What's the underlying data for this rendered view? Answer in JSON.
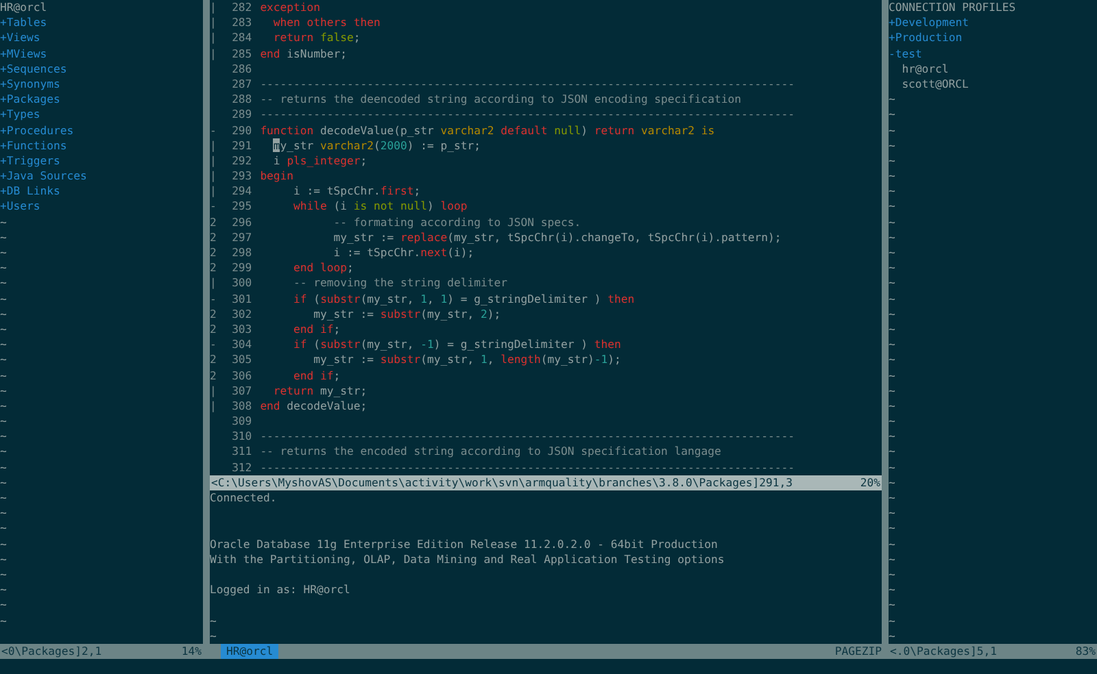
{
  "left_pane": {
    "title": "HR@orcl",
    "items": [
      {
        "label": "+Tables"
      },
      {
        "label": "+Views"
      },
      {
        "label": "+MViews"
      },
      {
        "label": "+Sequences"
      },
      {
        "label": "+Synonyms"
      },
      {
        "label": "+Packages"
      },
      {
        "label": "+Types"
      },
      {
        "label": "+Procedures"
      },
      {
        "label": "+Functions"
      },
      {
        "label": "+Triggers"
      },
      {
        "label": "+Java Sources"
      },
      {
        "label": "+DB Links"
      },
      {
        "label": "+Users"
      }
    ],
    "filler": [
      "~",
      "~",
      "~",
      "~",
      "~",
      "~",
      "~",
      "~",
      "~",
      "~",
      "~",
      "~",
      "~",
      "~",
      "~",
      "~",
      "~",
      "~",
      "~",
      "~",
      "~",
      "~",
      "~",
      "~",
      "~",
      "~",
      "~"
    ],
    "status_bar": {
      "file": "<0\\Packages]2,1",
      "percent": "14%"
    }
  },
  "editor": {
    "lines": [
      {
        "fold": "|",
        "number": "282",
        "tokens": [
          {
            "kind": "kw",
            "text": "exception"
          }
        ]
      },
      {
        "fold": "|",
        "number": "283",
        "tokens": [
          {
            "kind": "kw",
            "text": "  when others then"
          }
        ]
      },
      {
        "fold": "|",
        "number": "284",
        "tokens": [
          {
            "kind": "kw",
            "text": "  return"
          },
          {
            "kind": "const",
            "text": " false"
          },
          {
            "kind": "plain",
            "text": ";"
          }
        ]
      },
      {
        "fold": "|",
        "number": "285",
        "tokens": [
          {
            "kind": "kw",
            "text": "end"
          },
          {
            "kind": "plain",
            "text": " isNumber;"
          }
        ]
      },
      {
        "number": "286"
      },
      {
        "number": "287",
        "tokens": [
          {
            "kind": "comment",
            "text": "--------------------------------------------------------------------------------"
          }
        ]
      },
      {
        "number": "288",
        "tokens": [
          {
            "kind": "comment",
            "text": "-- returns the deencoded string according to JSON encoding specification"
          }
        ]
      },
      {
        "number": "289",
        "tokens": [
          {
            "kind": "comment",
            "text": "--------------------------------------------------------------------------------"
          }
        ]
      },
      {
        "fold": "-",
        "number": "290",
        "tokens": [
          {
            "kind": "kw",
            "text": "function"
          },
          {
            "kind": "plain",
            "text": " decodeValue(p_str "
          },
          {
            "kind": "type",
            "text": "varchar2"
          },
          {
            "kind": "kw",
            "text": " default"
          },
          {
            "kind": "const",
            "text": " null"
          },
          {
            "kind": "plain",
            "text": ") "
          },
          {
            "kind": "kw",
            "text": "return"
          },
          {
            "kind": "type",
            "text": " varchar2 is"
          }
        ]
      },
      {
        "fold": "|",
        "number": "291",
        "tokens": [
          {
            "kind": "cursor",
            "text": "m"
          },
          {
            "kind": "plain",
            "text": "y_str "
          },
          {
            "kind": "type",
            "text": "varchar2"
          },
          {
            "kind": "plain",
            "text": "("
          },
          {
            "kind": "num",
            "text": "2000"
          },
          {
            "kind": "plain",
            "text": ") := p_str;"
          }
        ]
      },
      {
        "fold": "|",
        "number": "292",
        "tokens": [
          {
            "kind": "plain",
            "text": "  i "
          },
          {
            "kind": "kw",
            "text": "pls_integer"
          },
          {
            "kind": "plain",
            "text": ";"
          }
        ]
      },
      {
        "fold": "|",
        "number": "293",
        "tokens": [
          {
            "kind": "kw",
            "text": "begin"
          }
        ]
      },
      {
        "fold": "|",
        "number": "294",
        "tokens": [
          {
            "kind": "plain",
            "text": "     i := tSpcChr."
          },
          {
            "kind": "kw",
            "text": "first"
          },
          {
            "kind": "plain",
            "text": ";"
          }
        ]
      },
      {
        "fold": "-",
        "number": "295",
        "tokens": [
          {
            "kind": "kw",
            "text": "     while"
          },
          {
            "kind": "plain",
            "text": " (i "
          },
          {
            "kind": "const",
            "text": "is not null"
          },
          {
            "kind": "plain",
            "text": ") "
          },
          {
            "kind": "kw",
            "text": "loop"
          }
        ]
      },
      {
        "fold": "2",
        "number": "296",
        "tokens": [
          {
            "kind": "comment",
            "text": "           -- formating according to JSON specs."
          }
        ]
      },
      {
        "fold": "2",
        "number": "297",
        "tokens": [
          {
            "kind": "plain",
            "text": "           my_str := "
          },
          {
            "kind": "kw",
            "text": "replace"
          },
          {
            "kind": "plain",
            "text": "(my_str, tSpcChr(i).changeTo, tSpcChr(i).pattern);"
          }
        ]
      },
      {
        "fold": "2",
        "number": "298",
        "tokens": [
          {
            "kind": "plain",
            "text": "           i := tSpcChr."
          },
          {
            "kind": "kw",
            "text": "next"
          },
          {
            "kind": "plain",
            "text": "(i);"
          }
        ]
      },
      {
        "fold": "2",
        "number": "299",
        "tokens": [
          {
            "kind": "kw",
            "text": "     end loop"
          },
          {
            "kind": "plain",
            "text": ";"
          }
        ]
      },
      {
        "fold": "|",
        "number": "300",
        "tokens": [
          {
            "kind": "comment",
            "text": "     -- removing the string delimiter"
          }
        ]
      },
      {
        "fold": "-",
        "number": "301",
        "tokens": [
          {
            "kind": "kw",
            "text": "     if"
          },
          {
            "kind": "plain",
            "text": " ("
          },
          {
            "kind": "kw",
            "text": "substr"
          },
          {
            "kind": "plain",
            "text": "(my_str, "
          },
          {
            "kind": "num",
            "text": "1"
          },
          {
            "kind": "plain",
            "text": ", "
          },
          {
            "kind": "num",
            "text": "1"
          },
          {
            "kind": "plain",
            "text": ") = g_stringDelimiter ) "
          },
          {
            "kind": "kw",
            "text": "then"
          }
        ]
      },
      {
        "fold": "2",
        "number": "302",
        "tokens": [
          {
            "kind": "plain",
            "text": "        my_str := "
          },
          {
            "kind": "kw",
            "text": "substr"
          },
          {
            "kind": "plain",
            "text": "(my_str, "
          },
          {
            "kind": "num",
            "text": "2"
          },
          {
            "kind": "plain",
            "text": ");"
          }
        ]
      },
      {
        "fold": "2",
        "number": "303",
        "tokens": [
          {
            "kind": "kw",
            "text": "     end if"
          },
          {
            "kind": "plain",
            "text": ";"
          }
        ]
      },
      {
        "fold": "-",
        "number": "304",
        "tokens": [
          {
            "kind": "kw",
            "text": "     if"
          },
          {
            "kind": "plain",
            "text": " ("
          },
          {
            "kind": "kw",
            "text": "substr"
          },
          {
            "kind": "plain",
            "text": "(my_str, "
          },
          {
            "kind": "num",
            "text": "-1"
          },
          {
            "kind": "plain",
            "text": ") = g_stringDelimiter ) "
          },
          {
            "kind": "kw",
            "text": "then"
          }
        ]
      },
      {
        "fold": "2",
        "number": "305",
        "tokens": [
          {
            "kind": "plain",
            "text": "        my_str := "
          },
          {
            "kind": "kw",
            "text": "substr"
          },
          {
            "kind": "plain",
            "text": "(my_str, "
          },
          {
            "kind": "num",
            "text": "1"
          },
          {
            "kind": "plain",
            "text": ", "
          },
          {
            "kind": "kw",
            "text": "length"
          },
          {
            "kind": "plain",
            "text": "(my_str)"
          },
          {
            "kind": "num",
            "text": "-1"
          },
          {
            "kind": "plain",
            "text": ");"
          }
        ]
      },
      {
        "fold": "2",
        "number": "306",
        "tokens": [
          {
            "kind": "kw",
            "text": "     end if"
          },
          {
            "kind": "plain",
            "text": ";"
          }
        ]
      },
      {
        "fold": "|",
        "number": "307",
        "tokens": [
          {
            "kind": "kw",
            "text": "  return"
          },
          {
            "kind": "plain",
            "text": " my_str;"
          }
        ]
      },
      {
        "fold": "|",
        "number": "308",
        "tokens": [
          {
            "kind": "kw",
            "text": "end"
          },
          {
            "kind": "plain",
            "text": " decodeValue;"
          }
        ]
      },
      {
        "number": "309"
      },
      {
        "number": "310",
        "tokens": [
          {
            "kind": "comment",
            "text": "--------------------------------------------------------------------------------"
          }
        ]
      },
      {
        "number": "311",
        "tokens": [
          {
            "kind": "comment",
            "text": "-- returns the encoded string according to JSON specification langage"
          }
        ]
      },
      {
        "number": "312",
        "tokens": [
          {
            "kind": "comment",
            "text": "--------------------------------------------------------------------------------"
          }
        ]
      }
    ],
    "status_bar": {
      "file": "<C:\\Users\\MyshovAS\\Documents\\activity\\work\\svn\\armquality\\branches\\3.8.0\\Packages]291,3",
      "percent": "20%"
    }
  },
  "output": {
    "lines": [
      {
        "kind": "text",
        "text": "Connected."
      },
      {
        "kind": "blank"
      },
      {
        "kind": "blank"
      },
      {
        "kind": "text",
        "text": "Oracle Database 11g Enterprise Edition Release 11.2.0.2.0 - 64bit Production"
      },
      {
        "kind": "text",
        "text": "With the Partitioning, OLAP, Data Mining and Real Application Testing options"
      },
      {
        "kind": "blank"
      },
      {
        "kind": "text",
        "text": "Logged in as: HR@orcl"
      },
      {
        "kind": "blank"
      },
      {
        "kind": "filler",
        "text": "~"
      },
      {
        "kind": "filler",
        "text": "~"
      }
    ],
    "status_bar": {
      "buffer": "HR@orcl",
      "label": "PAGEZIP"
    }
  },
  "right_pane": {
    "title": "CONNECTION PROFILES",
    "items": [
      {
        "label": "+Development"
      },
      {
        "label": "+Production"
      },
      {
        "label": "-test",
        "children": [
          {
            "label": "hr@orcl"
          },
          {
            "label": "scott@ORCL"
          }
        ]
      }
    ],
    "filler": [
      "~",
      "~",
      "~",
      "~",
      "~",
      "~",
      "~",
      "~",
      "~",
      "~",
      "~",
      "~",
      "~",
      "~",
      "~",
      "~",
      "~",
      "~",
      "~",
      "~",
      "~",
      "~",
      "~",
      "~",
      "~",
      "~",
      "~",
      "~",
      "~",
      "~",
      "~",
      "~",
      "~",
      "~",
      "~",
      "~"
    ],
    "status_bar": {
      "file": "<.0\\Packages]5,1",
      "percent": "83%"
    }
  }
}
